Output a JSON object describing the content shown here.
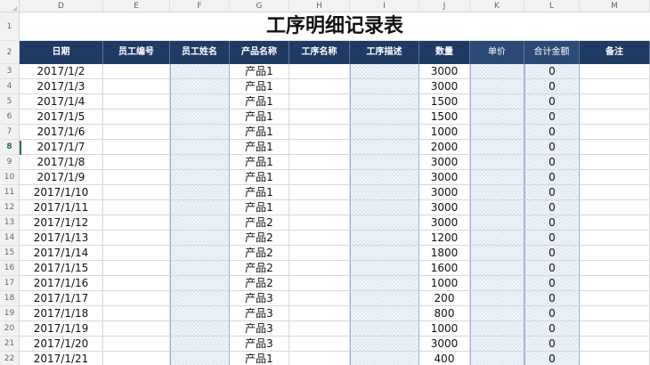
{
  "sheet": {
    "title": "工序明细记录表",
    "column_letters": [
      "D",
      "E",
      "F",
      "G",
      "H",
      "I",
      "J",
      "K",
      "L",
      "M"
    ],
    "row_numbers": [
      "1",
      "2",
      "3",
      "4",
      "5",
      "6",
      "7",
      "8",
      "9",
      "10",
      "11",
      "12",
      "13",
      "14",
      "15",
      "16",
      "17",
      "18",
      "19",
      "20",
      "21",
      "22"
    ],
    "active_row": "8",
    "header_bg": "#1f3b64",
    "shade_color": "#dce6f2",
    "headers": [
      "日期",
      "员工编号",
      "员工姓名",
      "产品名称",
      "工序名称",
      "工序描述",
      "数量",
      "单价",
      "合计金额",
      "备注"
    ],
    "rows": [
      {
        "date": "2017/1/2",
        "product": "产品1",
        "qty": "3000",
        "total": "0"
      },
      {
        "date": "2017/1/3",
        "product": "产品1",
        "qty": "3000",
        "total": "0"
      },
      {
        "date": "2017/1/4",
        "product": "产品1",
        "qty": "1500",
        "total": "0"
      },
      {
        "date": "2017/1/5",
        "product": "产品1",
        "qty": "1500",
        "total": "0"
      },
      {
        "date": "2017/1/6",
        "product": "产品1",
        "qty": "1000",
        "total": "0"
      },
      {
        "date": "2017/1/7",
        "product": "产品1",
        "qty": "2000",
        "total": "0"
      },
      {
        "date": "2017/1/8",
        "product": "产品1",
        "qty": "3000",
        "total": "0"
      },
      {
        "date": "2017/1/9",
        "product": "产品1",
        "qty": "3000",
        "total": "0"
      },
      {
        "date": "2017/1/10",
        "product": "产品1",
        "qty": "3000",
        "total": "0"
      },
      {
        "date": "2017/1/11",
        "product": "产品1",
        "qty": "3000",
        "total": "0"
      },
      {
        "date": "2017/1/12",
        "product": "产品2",
        "qty": "3000",
        "total": "0"
      },
      {
        "date": "2017/1/13",
        "product": "产品2",
        "qty": "1200",
        "total": "0"
      },
      {
        "date": "2017/1/14",
        "product": "产品2",
        "qty": "1800",
        "total": "0"
      },
      {
        "date": "2017/1/15",
        "product": "产品2",
        "qty": "1600",
        "total": "0"
      },
      {
        "date": "2017/1/16",
        "product": "产品2",
        "qty": "1000",
        "total": "0"
      },
      {
        "date": "2017/1/17",
        "product": "产品3",
        "qty": "200",
        "total": "0"
      },
      {
        "date": "2017/1/18",
        "product": "产品3",
        "qty": "800",
        "total": "0"
      },
      {
        "date": "2017/1/19",
        "product": "产品3",
        "qty": "1000",
        "total": "0"
      },
      {
        "date": "2017/1/20",
        "product": "产品3",
        "qty": "3000",
        "total": "0"
      },
      {
        "date": "2017/1/21",
        "product": "产品1",
        "qty": "400",
        "total": "0"
      }
    ]
  }
}
